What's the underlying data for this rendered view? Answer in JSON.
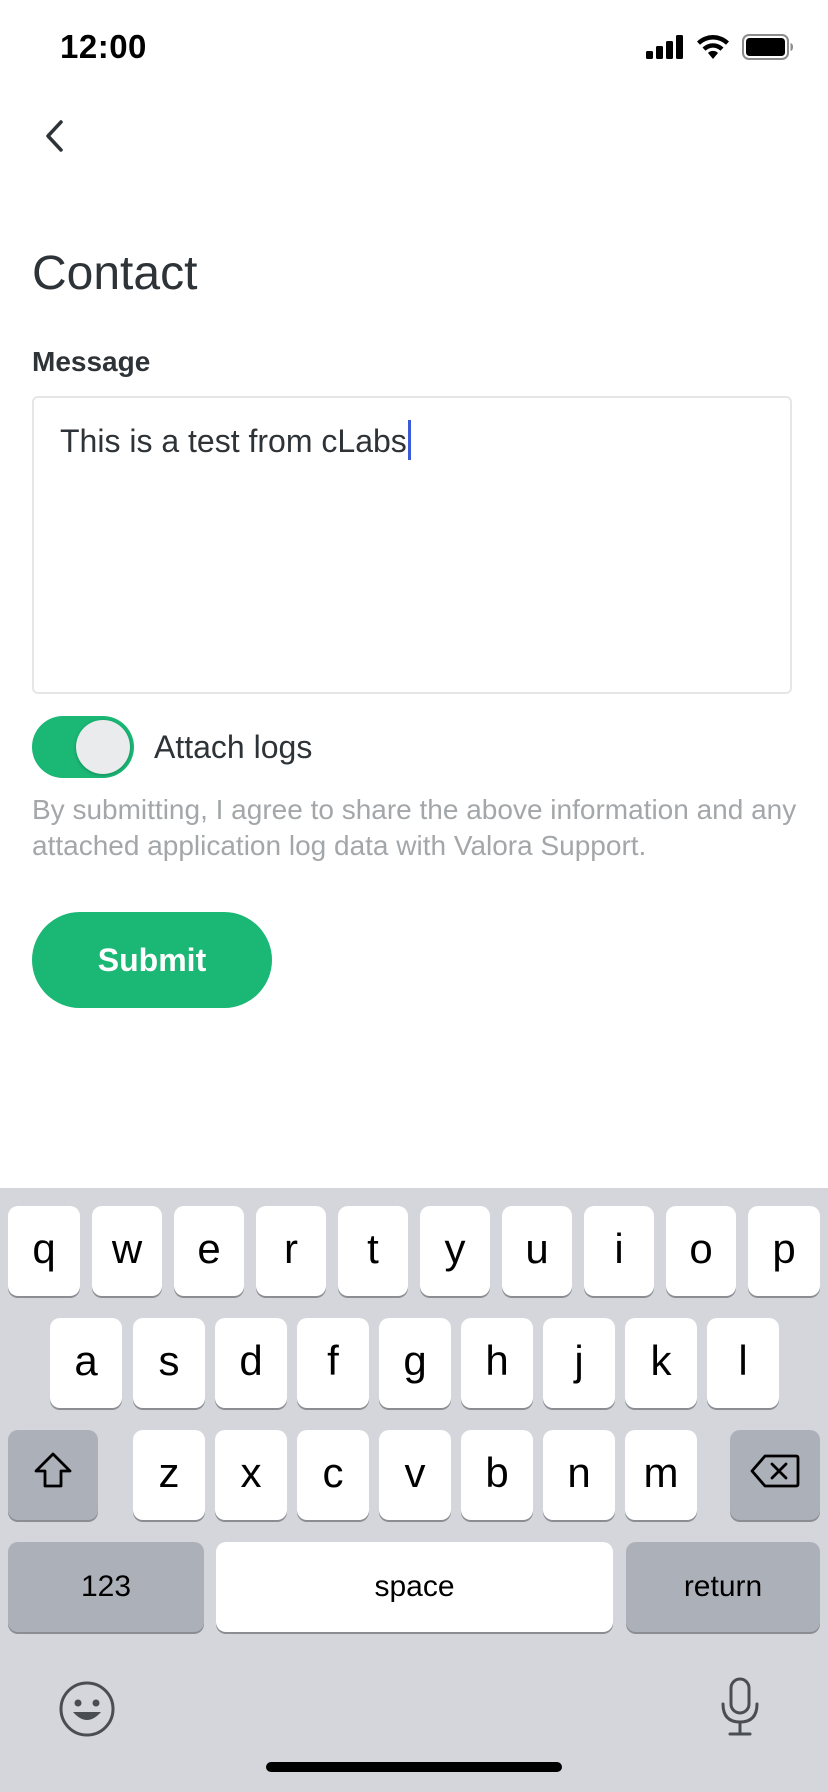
{
  "status_bar": {
    "time": "12:00",
    "icons": [
      "signal-icon",
      "wifi-icon",
      "battery-icon"
    ]
  },
  "header": {
    "back_icon": "chevron-left-icon",
    "title": "Contact"
  },
  "form": {
    "message_label": "Message",
    "message_value": "This is a test from cLabs",
    "attach_logs_label": "Attach logs",
    "attach_logs_enabled": true,
    "disclaimer": "By submitting, I agree to share the above information and any attached application log data with Valora Support.",
    "submit_label": "Submit"
  },
  "keyboard": {
    "row1": [
      "q",
      "w",
      "e",
      "r",
      "t",
      "y",
      "u",
      "i",
      "o",
      "p"
    ],
    "row2": [
      "a",
      "s",
      "d",
      "f",
      "g",
      "h",
      "j",
      "k",
      "l"
    ],
    "row3": [
      "z",
      "x",
      "c",
      "v",
      "b",
      "n",
      "m"
    ],
    "numbers_label": "123",
    "space_label": "space",
    "return_label": "return",
    "shift_icon": "shift-icon",
    "delete_icon": "backspace-icon",
    "emoji_icon": "emoji-icon",
    "dictation_icon": "microphone-icon"
  },
  "colors": {
    "accent": "#1ab775",
    "caret": "#3d5ad8",
    "text": "#2e3338",
    "muted": "#a4a7a9",
    "keyboard_bg": "#d4d6db"
  }
}
